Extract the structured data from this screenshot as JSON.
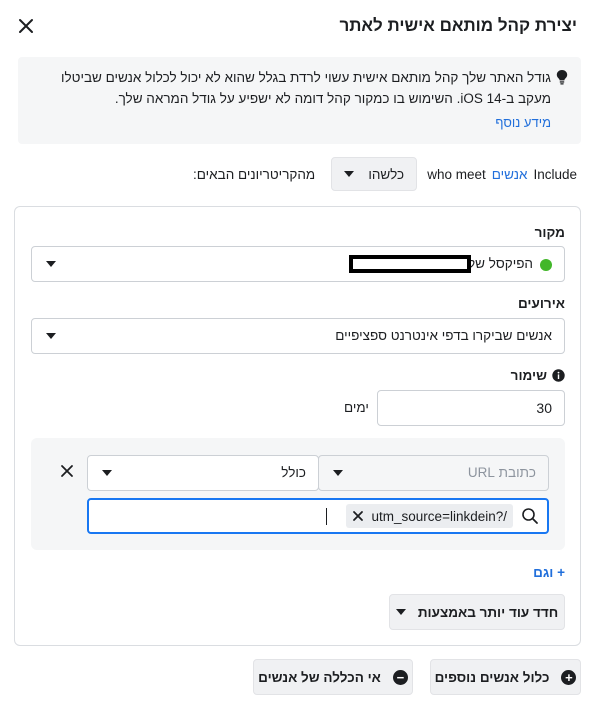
{
  "dialog": {
    "title": "יצירת קהל מותאם אישית לאתר"
  },
  "banner": {
    "text": "גודל האתר שלך קהל מותאם אישית עשוי לרדת בגלל שהוא לא יכול לכלול אנשים שביטלו מעקב ב-iOS 14. השימוש בו כמקור קהל דומה לא ישפיע על גודל המראה שלך.",
    "link": "מידע נוסף"
  },
  "include": {
    "word_include": "Include",
    "word_people": "אנשים",
    "word_who_meet": "who meet",
    "any_option": "כלשהו",
    "criteria_text": "מהקריטריונים הבאים:"
  },
  "source": {
    "label": "מקור",
    "value_prefix": "הפיקסל של"
  },
  "events": {
    "label": "אירועים",
    "value": "אנשים שביקרו בדפי אינטרנט ספציפיים"
  },
  "retention": {
    "label": "שימור",
    "value": "30",
    "unit": "ימים"
  },
  "rule": {
    "field_placeholder": "כתובת URL",
    "operator": "כולל",
    "tag_value": "utm_source=linkdein?/"
  },
  "and_link": "+ וגם",
  "refine_button": "חדד עוד יותר באמצעות",
  "footer": {
    "include_more": "כלול אנשים נוספים",
    "exclude": "אי הכללה של אנשים"
  }
}
